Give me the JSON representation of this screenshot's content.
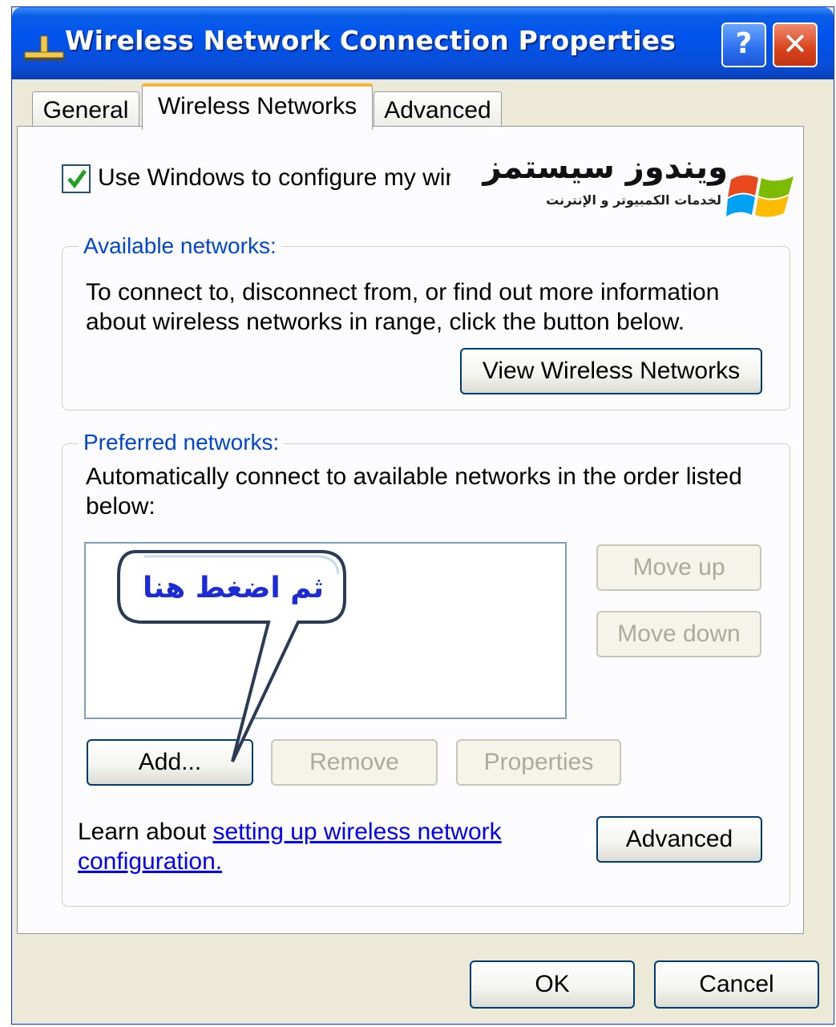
{
  "window": {
    "title": "Wireless Network Connection Properties",
    "help_label": "?",
    "close_label": "✕"
  },
  "tabs": [
    {
      "label": "General",
      "selected": false
    },
    {
      "label": "Wireless Networks",
      "selected": true
    },
    {
      "label": "Advanced",
      "selected": false
    }
  ],
  "use_windows_checkbox": {
    "label": "Use Windows to configure my wir",
    "checked": true
  },
  "watermark": {
    "title": "ويندوز سيستمز",
    "subtitle": "لخدمات الكمبيوتر و الإنترنت"
  },
  "available_networks": {
    "title": "Available networks:",
    "description": "To connect to, disconnect from, or find out more information about wireless networks in range, click the button below.",
    "view_button": "View Wireless Networks"
  },
  "preferred_networks": {
    "title": "Preferred networks:",
    "description": "Automatically connect to available networks in the order listed below:",
    "move_up": "Move up",
    "move_down": "Move down",
    "add": "Add...",
    "remove": "Remove",
    "properties": "Properties"
  },
  "callout": {
    "text": "ثم اضغط هنا"
  },
  "learn": {
    "prefix": "Learn about ",
    "link_line1": "setting up wireless network",
    "link_line2": "configuration."
  },
  "advanced_button": "Advanced",
  "footer": {
    "ok": "OK",
    "cancel": "Cancel"
  },
  "colors": {
    "titlebar": "#0053ee",
    "dialog_bg": "#ece9d8",
    "group_title": "#0046d5",
    "link": "#0000ff",
    "callout_text": "#1b2bd6",
    "selected_tab_accent": "#f8b23c"
  }
}
